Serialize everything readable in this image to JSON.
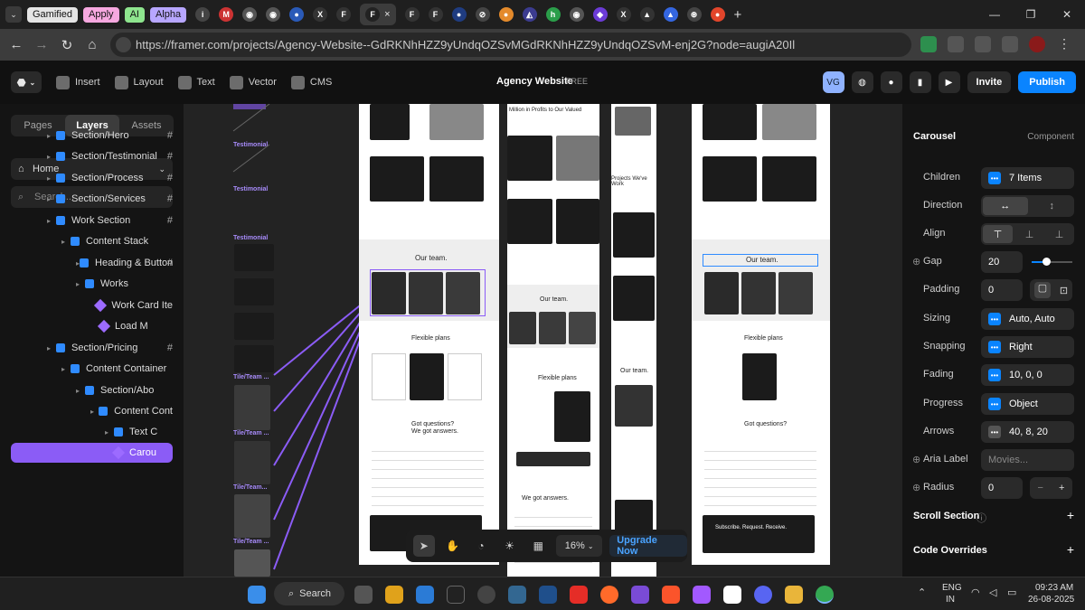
{
  "browser": {
    "bookmarks": [
      "Gamified",
      "Apply",
      "AI",
      "Alpha"
    ],
    "bookmark_colors": [
      "#e5e5e5",
      "#f7a8e0",
      "#8ee58e",
      "#b7a6ff"
    ],
    "url": "https://framer.com/projects/Agency-Website--GdRKNhHZZ9yUndqOZSvMGdRKNhHZZ9yUndqOZSvM-enj2G?node=augiA20Il",
    "url_host": "framer.com",
    "icons": [
      "back-icon",
      "forward-icon",
      "reload-icon",
      "home-icon",
      "menu-icon",
      "new-tab-icon"
    ]
  },
  "framer_toolbar": {
    "items": [
      "Insert",
      "Layout",
      "Text",
      "Vector",
      "CMS"
    ],
    "doc_title": "Agency Website",
    "plan": "FREE",
    "avatar": "VG",
    "invite": "Invite",
    "publish": "Publish"
  },
  "left_panel": {
    "tabs": [
      "Pages",
      "Layers",
      "Assets"
    ],
    "active_tab": "Layers",
    "page": "Home",
    "search_placeholder": "Search...",
    "layers": [
      {
        "label": "Section/Hero",
        "indent": 0,
        "type": "stack"
      },
      {
        "label": "Section/Testimonial",
        "indent": 0,
        "type": "stack"
      },
      {
        "label": "Section/Process",
        "indent": 0,
        "type": "stack"
      },
      {
        "label": "Section/Services",
        "indent": 0,
        "type": "stack"
      },
      {
        "label": "Work Section",
        "indent": 0,
        "type": "stack"
      },
      {
        "label": "Content Stack",
        "indent": 1,
        "type": "stack"
      },
      {
        "label": "Heading & Button",
        "indent": 2,
        "type": "stack"
      },
      {
        "label": "Works",
        "indent": 2,
        "type": "stack"
      },
      {
        "label": "Work Card Ite",
        "indent": 3,
        "type": "component"
      },
      {
        "label": "Load M",
        "indent": 3,
        "type": "component"
      },
      {
        "label": "Section/Pricing",
        "indent": 0,
        "type": "stack"
      },
      {
        "label": "Content Container",
        "indent": 1,
        "type": "stack"
      },
      {
        "label": "Section/Abo",
        "indent": 2,
        "type": "stack"
      },
      {
        "label": "Content Cont",
        "indent": 3,
        "type": "stack"
      },
      {
        "label": "Text C",
        "indent": 4,
        "type": "stack"
      },
      {
        "label": "Carou",
        "indent": 4,
        "type": "component"
      }
    ],
    "selected_layer": "Carou"
  },
  "canvas": {
    "frame_labels": [
      "Testimonial",
      "Testimonial",
      "Testimonial",
      "Tile/Team ...",
      "Tile/Team ...",
      "Tile/Team...",
      "Tile/Team ..."
    ],
    "section_titles": [
      "Our team.",
      "Flexible plans",
      "Got questions?",
      "We got answers.",
      "Subscribe. Request. Receive.",
      "Projects We've Work",
      "Million in Profits to Our Valued"
    ],
    "zoom": "16%",
    "upgrade": "Upgrade Now"
  },
  "right_panel": {
    "title": "Carousel",
    "badge": "Component",
    "props": [
      {
        "label": "Children",
        "value": "7 Items",
        "kind": "blue"
      },
      {
        "label": "Direction",
        "value": "",
        "kind": "segment2"
      },
      {
        "label": "Align",
        "value": "",
        "kind": "segment3"
      },
      {
        "label": "Gap",
        "value": "20",
        "kind": "slider",
        "slider_pct": 0.35
      },
      {
        "label": "Padding",
        "value": "0",
        "kind": "padding"
      },
      {
        "label": "Sizing",
        "value": "Auto, Auto",
        "kind": "blue"
      },
      {
        "label": "Snapping",
        "value": "Right",
        "kind": "blue"
      },
      {
        "label": "Fading",
        "value": "10, 0, 0",
        "kind": "blue"
      },
      {
        "label": "Progress",
        "value": "Object",
        "kind": "blue"
      },
      {
        "label": "Arrows",
        "value": "40, 8, 20",
        "kind": "gray"
      },
      {
        "label": "Aria Label",
        "value": "Movies...",
        "kind": "text"
      },
      {
        "label": "Radius",
        "value": "0",
        "kind": "stepper"
      }
    ],
    "scroll_section": "Scroll Section",
    "code_overrides": "Code Overrides"
  },
  "taskbar": {
    "search": "Search",
    "lang": "ENG",
    "region": "IN",
    "time": "09:23 AM",
    "date": "26-08-2025"
  }
}
